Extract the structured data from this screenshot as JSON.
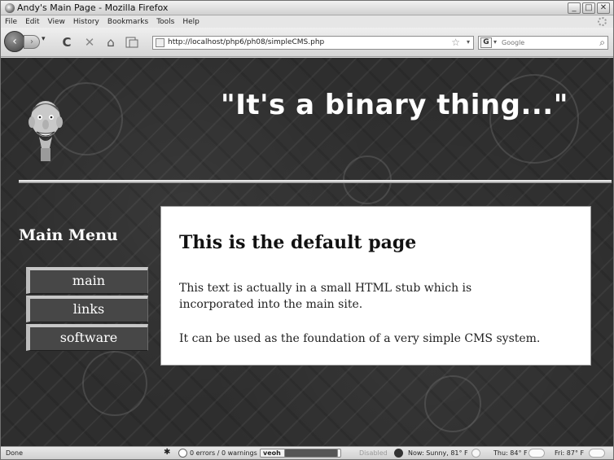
{
  "window": {
    "title": "Andy's Main Page - Mozilla Firefox"
  },
  "window_buttons": {
    "minimize": "_",
    "maximize": "□",
    "close": "✕"
  },
  "menubar": {
    "items": [
      "File",
      "Edit",
      "View",
      "History",
      "Bookmarks",
      "Tools",
      "Help"
    ]
  },
  "toolbar": {
    "back_glyph": "‹",
    "forward_glyph": "›",
    "dropdown_glyph": "▾",
    "reload_glyph": "C",
    "stop_glyph": "✕",
    "home_glyph": "⌂",
    "url": "http://localhost/php6/ph08/simpleCMS.php",
    "bookmark_glyph": "☆",
    "search_engine_label": "G",
    "search_placeholder": "Google",
    "search_go_glyph": "⌕"
  },
  "page": {
    "header_quote": "\"It's a binary thing...\"",
    "menu_heading": "Main Menu",
    "menu_items": [
      "main",
      "links",
      "software"
    ],
    "panel_heading": "This is the default page",
    "paragraph1": "This text is actually in a small HTML stub which is incorporated into the main site.",
    "paragraph2": "It can be used as the foundation of a very simple CMS system."
  },
  "statusbar": {
    "status": "Done",
    "errors": "0 errors / 0 warnings",
    "addon_label": "veoh",
    "disabled": "Disabled",
    "now_weather": "Now: Sunny, 81° F",
    "thu_weather": "Thu: 84° F",
    "fri_weather": "Fri: 87° F"
  }
}
